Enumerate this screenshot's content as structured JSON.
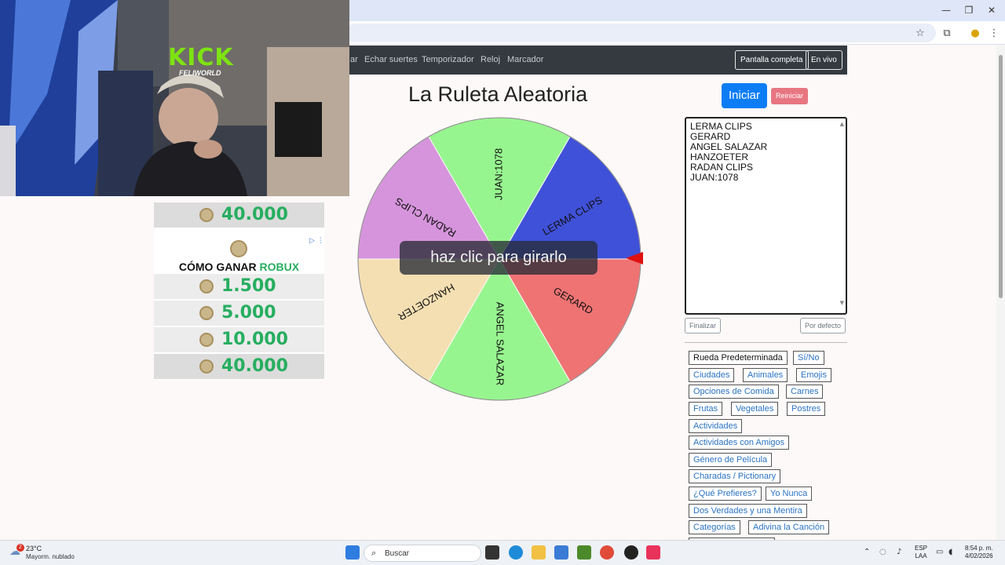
{
  "window": {
    "min": "—",
    "restore": "❐",
    "close": "✕"
  },
  "toolbar": {
    "star_icon": "☆",
    "ext_icon": "⧉",
    "menu_icon": "⋮"
  },
  "navbar": {
    "links": [
      "ar",
      "Echar suertes",
      "Temporizador",
      "Reloj",
      "Marcador"
    ],
    "fullscreen": "Pantalla completa",
    "live": "En vivo"
  },
  "page": {
    "title": "La Ruleta Aleatoria",
    "start": "Iniciar",
    "reset": "Reiniciar",
    "overlay": "haz clic para girarlo",
    "names": [
      "LERMA CLIPS",
      "GERARD",
      "ANGEL SALAZAR",
      "HANZOETER",
      "RADAN CLIPS",
      "JUAN:1078"
    ],
    "finish": "Finalizar",
    "default": "Por defecto"
  },
  "wheel": {
    "segments": [
      {
        "label": "LERMA CLIPS",
        "color": "#3f51d8"
      },
      {
        "label": "GERARD",
        "color": "#ef7373"
      },
      {
        "label": "ANGEL SALAZAR",
        "color": "#97f58f"
      },
      {
        "label": "HANZOETER",
        "color": "#f4dfb2"
      },
      {
        "label": "RADAN CLIPS",
        "color": "#d694dc"
      },
      {
        "label": "JUAN:1078",
        "color": "#97f58f"
      }
    ],
    "pointer_color": "#e01010"
  },
  "presets": [
    "Rueda Predeterminada",
    "Sí/No",
    "Ciudades",
    "Animales",
    "Emojis",
    "Opciones de Comida",
    "Carnes",
    "Frutas",
    "Vegetales",
    "Postres",
    "Actividades",
    "Actividades con Amigos",
    "Género de Película",
    "Charadas / Pictionary",
    "¿Qué Prefieres?",
    "Yo Nunca",
    "Dos Verdades y una Mentira",
    "Categorías",
    "Adivina la Canción"
  ],
  "stream": {
    "kick": "KICK",
    "channel": "FELIWORLD"
  },
  "ad": {
    "amounts": [
      "40.000",
      "1.500",
      "5.000",
      "10.000",
      "40.000"
    ],
    "headline_a": "CÓMO GANAR ",
    "headline_b": "ROBUX",
    "ad_icons": "▷ ⋮"
  },
  "taskbar": {
    "temp": "23°C",
    "weather": "Mayorm. nublado",
    "notif": "2",
    "search": "Buscar",
    "lang1": "ESP",
    "lang2": "LAA",
    "time": "8:54 p. m.",
    "date": "4/02/2026"
  }
}
